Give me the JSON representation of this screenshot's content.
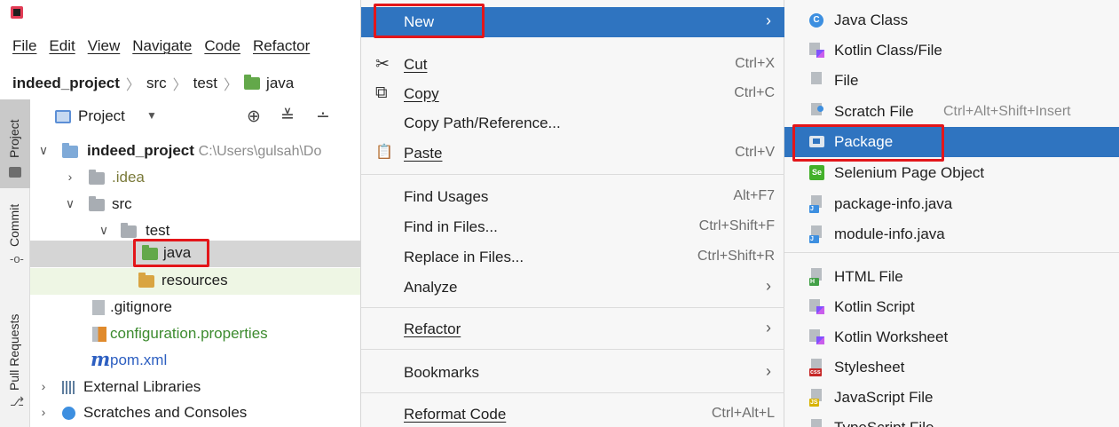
{
  "menubar": [
    "File",
    "Edit",
    "View",
    "Navigate",
    "Code",
    "Refactor"
  ],
  "breadcrumb": {
    "project": "indeed_project",
    "sep": "〉",
    "src": "src",
    "test": "test",
    "java": "java"
  },
  "toolstripe": {
    "project": "Project",
    "commit": "Commit",
    "pull_requests": "Pull Requests"
  },
  "project_panel": {
    "title": "Project",
    "dropdown_icon": "▼",
    "tools": {
      "locate": "⊕",
      "collapse": "≚",
      "expand": "∸"
    }
  },
  "tree": {
    "root_name": "indeed_project",
    "root_path": "C:\\Users\\gulsah\\Do",
    "idea": ".idea",
    "src": "src",
    "test": "test",
    "java": "java",
    "resources": "resources",
    "gitignore": ".gitignore",
    "configuration": "configuration.properties",
    "pom": "pom.xml",
    "pom_icon": "m",
    "external_libraries": "External Libraries",
    "scratches": "Scratches and Consoles",
    "arrow_open": "∨",
    "arrow_closed": "›"
  },
  "context_menu": {
    "new": "New",
    "cut": "Cut",
    "cut_sc": "Ctrl+X",
    "cut_icon": "✂",
    "copy": "Copy",
    "copy_sc": "Ctrl+C",
    "copy_icon": "⧉",
    "copy_path": "Copy Path/Reference...",
    "paste": "Paste",
    "paste_sc": "Ctrl+V",
    "paste_icon": "📋",
    "find_usages": "Find Usages",
    "find_usages_sc": "Alt+F7",
    "find_in_files": "Find in Files...",
    "find_in_files_sc": "Ctrl+Shift+F",
    "replace_in_files": "Replace in Files...",
    "replace_in_files_sc": "Ctrl+Shift+R",
    "analyze": "Analyze",
    "refactor": "Refactor",
    "bookmarks": "Bookmarks",
    "reformat": "Reformat Code",
    "reformat_sc": "Ctrl+Alt+L",
    "chevron": "›"
  },
  "submenu": {
    "java_class": "Java Class",
    "kotlin_class": "Kotlin Class/File",
    "file": "File",
    "scratch_file": "Scratch File",
    "scratch_sc": "Ctrl+Alt+Shift+Insert",
    "package": "Package",
    "selenium": "Selenium Page Object",
    "package_info": "package-info.java",
    "module_info": "module-info.java",
    "html_file": "HTML File",
    "kotlin_script": "Kotlin Script",
    "kotlin_worksheet": "Kotlin Worksheet",
    "stylesheet": "Stylesheet",
    "javascript_file": "JavaScript File",
    "typescript_file": "TypeScript File",
    "icon_tags": {
      "class": "C",
      "java": "J",
      "html": "H",
      "css": "css",
      "js": "JS",
      "ts": "TS",
      "se": "Se"
    }
  },
  "colors": {
    "highlight": "#2f74c0",
    "annotation_red": "#e3161a",
    "selected_row": "#d5d5d5"
  }
}
